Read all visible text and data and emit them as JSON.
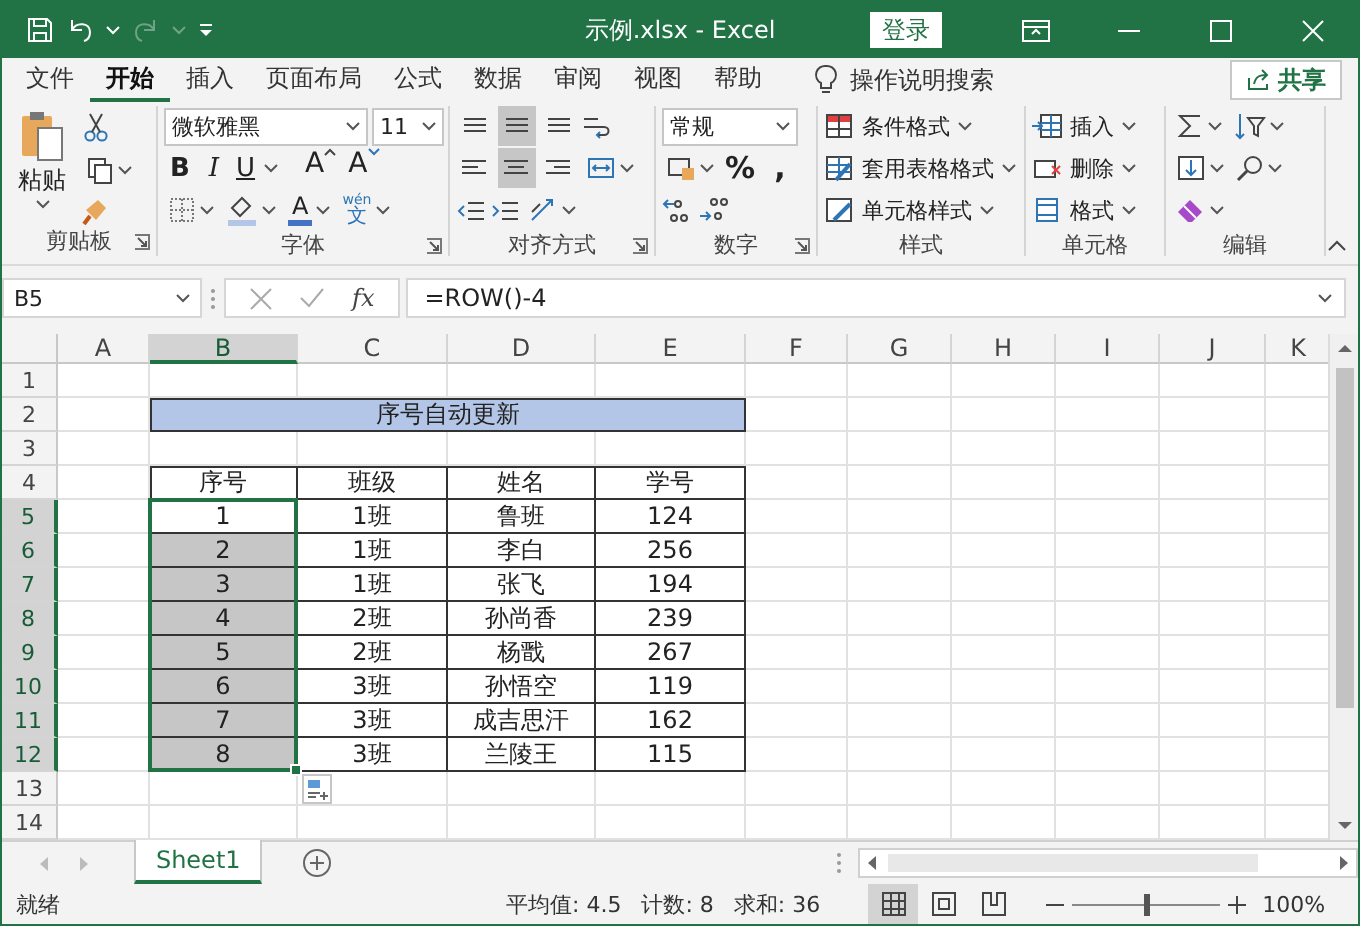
{
  "window": {
    "title": "示例.xlsx  -  Excel",
    "login": "登录"
  },
  "tabs": [
    {
      "label": "文件",
      "selected": false
    },
    {
      "label": "开始",
      "selected": true
    },
    {
      "label": "插入",
      "selected": false
    },
    {
      "label": "页面布局",
      "selected": false
    },
    {
      "label": "公式",
      "selected": false
    },
    {
      "label": "数据",
      "selected": false
    },
    {
      "label": "审阅",
      "selected": false
    },
    {
      "label": "视图",
      "selected": false
    },
    {
      "label": "帮助",
      "selected": false
    }
  ],
  "tell_me": {
    "placeholder": "操作说明搜索"
  },
  "share": "共享",
  "ribbon": {
    "groups": [
      {
        "kind": "clipboard",
        "label": "剪贴板",
        "paste": "粘贴"
      },
      {
        "kind": "font",
        "label": "字体",
        "font": "微软雅黑",
        "size": "11",
        "styles": [
          "B",
          "I",
          "U"
        ],
        "grow": "A",
        "shrink": "A",
        "font_color": "A",
        "phonetic_top": "wén",
        "phonetic": "文"
      },
      {
        "kind": "alignment",
        "label": "对齐方式",
        "vertical_align": [
          {
            "selected": false
          },
          {
            "selected": true
          },
          {
            "selected": false
          }
        ],
        "horizontal_align": [
          {
            "selected": false
          },
          {
            "selected": true
          },
          {
            "selected": false
          }
        ]
      },
      {
        "kind": "number",
        "label": "数字",
        "format": "常规",
        "percent": "%",
        "comma": ","
      },
      {
        "kind": "styles",
        "label": "样式",
        "commands": [
          "条件格式",
          "套用表格格式",
          "单元格样式"
        ]
      },
      {
        "kind": "cells",
        "label": "单元格",
        "commands": [
          "插入",
          "删除",
          "格式"
        ]
      },
      {
        "kind": "editing",
        "label": "编辑"
      }
    ]
  },
  "formula_bar": {
    "name_box": "B5",
    "function_button": "fx",
    "formula": "=ROW()-4"
  },
  "sheet": {
    "columns": [
      {
        "label": "A",
        "selected": false
      },
      {
        "label": "B",
        "selected": true
      },
      {
        "label": "C",
        "selected": false
      },
      {
        "label": "D",
        "selected": false
      },
      {
        "label": "E",
        "selected": false
      },
      {
        "label": "F",
        "selected": false
      },
      {
        "label": "G",
        "selected": false
      },
      {
        "label": "H",
        "selected": false
      },
      {
        "label": "I",
        "selected": false
      },
      {
        "label": "J",
        "selected": false
      },
      {
        "label": "K",
        "selected": false
      }
    ],
    "rows": [
      {
        "label": "1",
        "selected": false
      },
      {
        "label": "2",
        "selected": false
      },
      {
        "label": "3",
        "selected": false
      },
      {
        "label": "4",
        "selected": false
      },
      {
        "label": "5",
        "selected": true
      },
      {
        "label": "6",
        "selected": true
      },
      {
        "label": "7",
        "selected": true
      },
      {
        "label": "8",
        "selected": true
      },
      {
        "label": "9",
        "selected": true
      },
      {
        "label": "10",
        "selected": true
      },
      {
        "label": "11",
        "selected": true
      },
      {
        "label": "12",
        "selected": true
      },
      {
        "label": "13",
        "selected": false
      },
      {
        "label": "14",
        "selected": false
      }
    ],
    "title": "序号自动更新",
    "table": {
      "header": [
        "序号",
        "班级",
        "姓名",
        "学号"
      ],
      "rows": [
        {
          "cells": [
            "1",
            "1班",
            "鲁班",
            "124"
          ],
          "selected": true,
          "active": true
        },
        {
          "cells": [
            "2",
            "1班",
            "李白",
            "256"
          ],
          "selected": true,
          "active": false
        },
        {
          "cells": [
            "3",
            "1班",
            "张飞",
            "194"
          ],
          "selected": true,
          "active": false
        },
        {
          "cells": [
            "4",
            "2班",
            "孙尚香",
            "239"
          ],
          "selected": true,
          "active": false
        },
        {
          "cells": [
            "5",
            "2班",
            "杨戬",
            "267"
          ],
          "selected": true,
          "active": false
        },
        {
          "cells": [
            "6",
            "3班",
            "孙悟空",
            "119"
          ],
          "selected": true,
          "active": false
        },
        {
          "cells": [
            "7",
            "3班",
            "成吉思汗",
            "162"
          ],
          "selected": true,
          "active": false
        },
        {
          "cells": [
            "8",
            "3班",
            "兰陵王",
            "115"
          ],
          "selected": true,
          "active": false
        }
      ]
    }
  },
  "sheet_tabs": [
    {
      "label": "Sheet1",
      "selected": true
    }
  ],
  "status_bar": {
    "status": "就绪",
    "average": "平均值: 4.5",
    "count": "计数: 8",
    "sum": "求和: 36",
    "views": [
      {
        "selected": true
      },
      {
        "selected": false
      },
      {
        "selected": false
      }
    ],
    "zoom": {
      "level": 0.5,
      "reading": "100%"
    }
  }
}
